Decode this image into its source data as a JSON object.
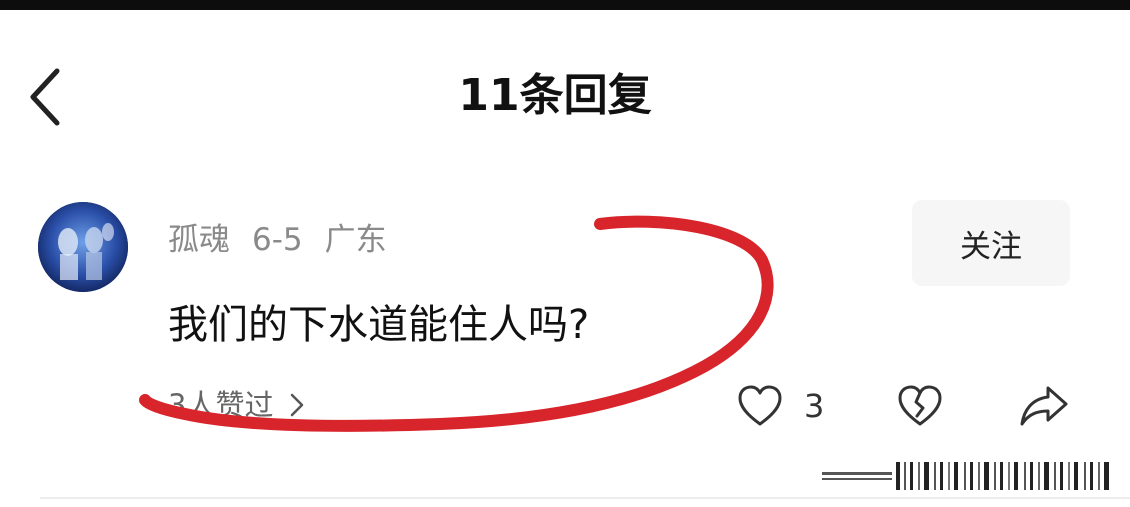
{
  "header": {
    "title": "11条回复"
  },
  "comment": {
    "username": "孤魂",
    "date": "6-5",
    "location": "广东",
    "follow_label": "关注",
    "text": "我们的下水道能住人吗?",
    "likes_summary": "3人赞过",
    "like_count": "3"
  },
  "colors": {
    "marker": "#d8242b",
    "meta_gray": "#8a8a8a",
    "follow_bg": "#f6f6f6"
  },
  "icons": [
    "back-arrow-icon",
    "heart-icon",
    "broken-heart-icon",
    "share-icon",
    "chevron-right-icon"
  ]
}
